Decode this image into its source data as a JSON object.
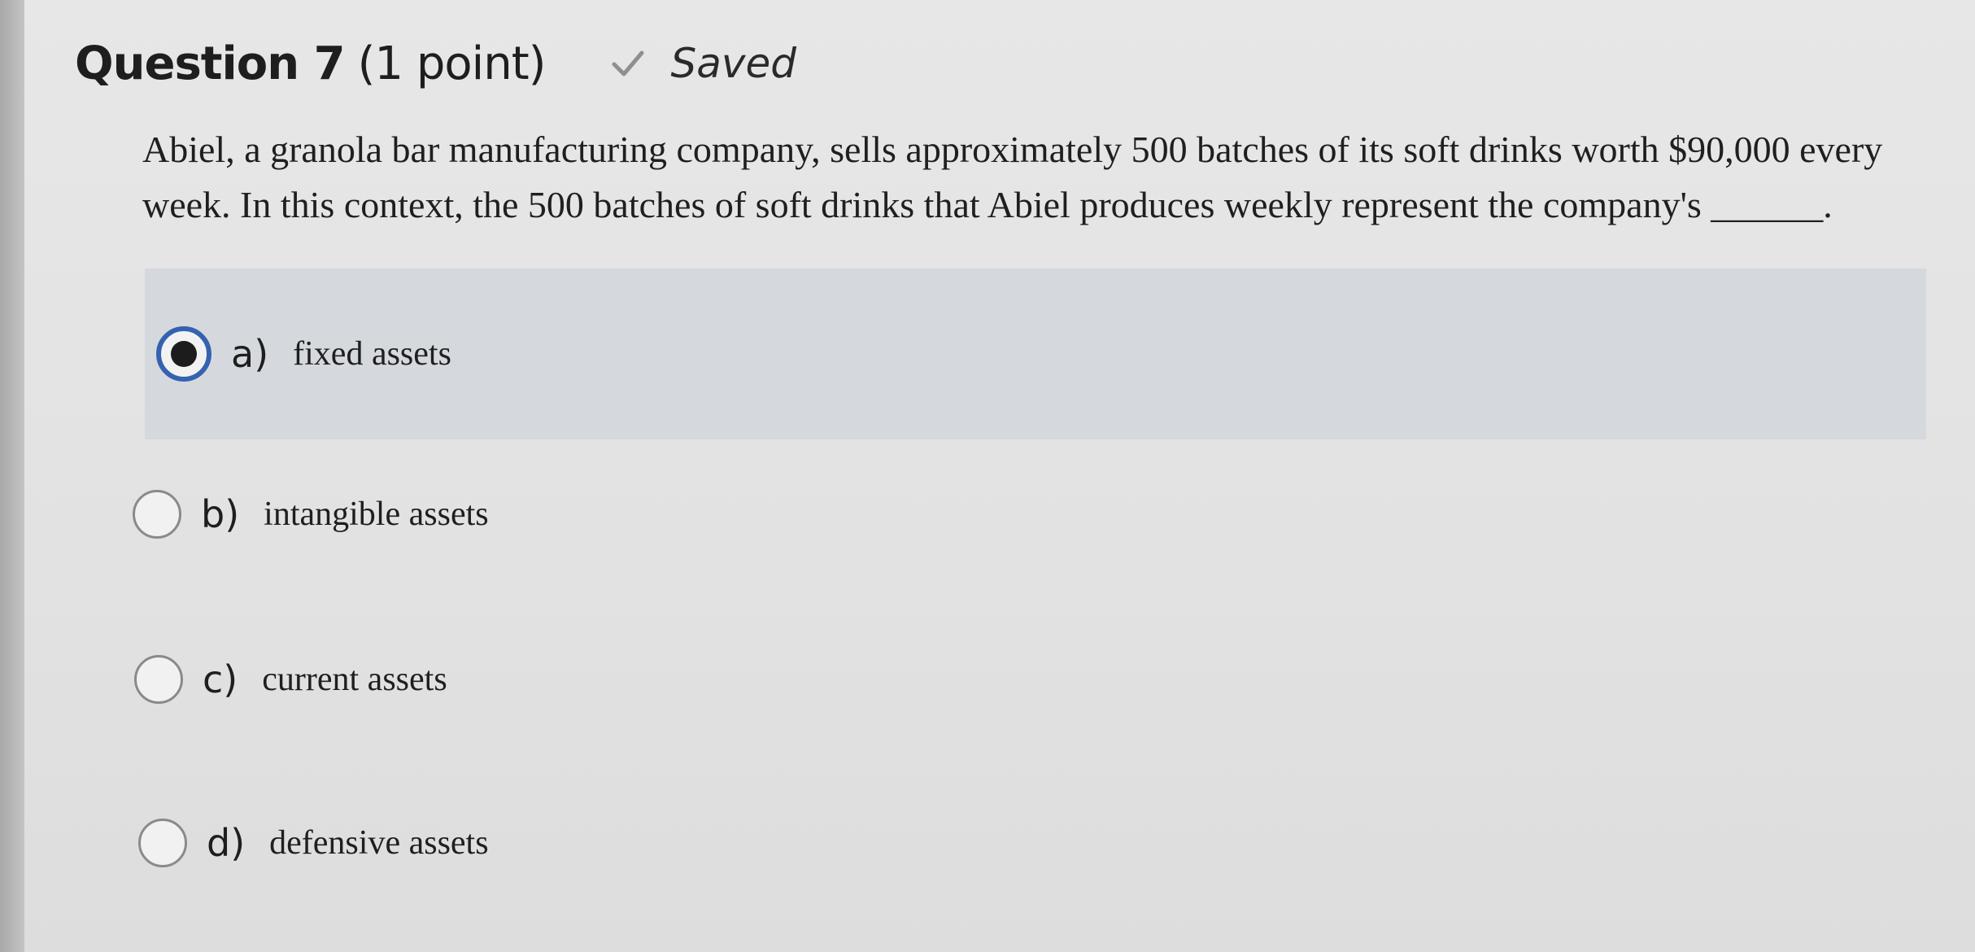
{
  "question": {
    "title": "Question 7",
    "points": "(1 point)",
    "status": "Saved",
    "prompt": "Abiel, a granola bar manufacturing company, sells approximately 500 batches of its soft drinks worth $90,000 every week. In this context, the 500 batches of soft drinks that Abiel produces weekly represent the company's ______."
  },
  "options": [
    {
      "letter": "a)",
      "text": "fixed assets",
      "selected": true
    },
    {
      "letter": "b)",
      "text": "intangible assets",
      "selected": false
    },
    {
      "letter": "c)",
      "text": "current assets",
      "selected": false
    },
    {
      "letter": "d)",
      "text": "defensive assets",
      "selected": false
    }
  ],
  "icons": {
    "saved": "check-icon"
  },
  "colors": {
    "selected_background": "#d5d9de",
    "selected_radio_ring": "#3562b0"
  }
}
